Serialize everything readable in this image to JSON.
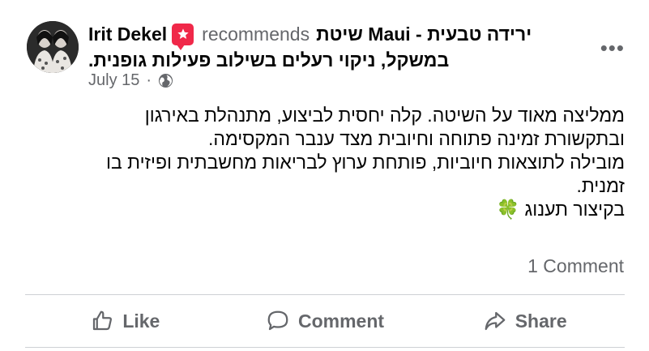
{
  "post": {
    "author": "Irit Dekel",
    "recommends_text": "recommends",
    "page_name": "ירידה טבעית - Maui שיטת",
    "page_name_cont": "במשקל, ניקוי רעלים בשילוב פעילות גופנית.",
    "date": "July 15",
    "dot": "·",
    "body_lines": [
      "ממליצה מאוד על השיטה. קלה יחסית לביצוע, מתנהלת באירגון",
      "ובתקשורת זמינה פתוחה וחיובית מצד ענבר המקסימה.",
      "מובילה לתוצאות חיוביות, פותחת ערוץ לבריאות מחשבתית ופיזית בו",
      "זמנית.",
      "בקיצור תענוג"
    ],
    "clover": "🍀",
    "comments_count": "1 Comment"
  },
  "actions": {
    "like": "Like",
    "comment": "Comment",
    "share": "Share"
  },
  "colors": {
    "recommend_badge": "#f02849",
    "secondary_text": "#65676b",
    "divider": "#ced0d4"
  }
}
